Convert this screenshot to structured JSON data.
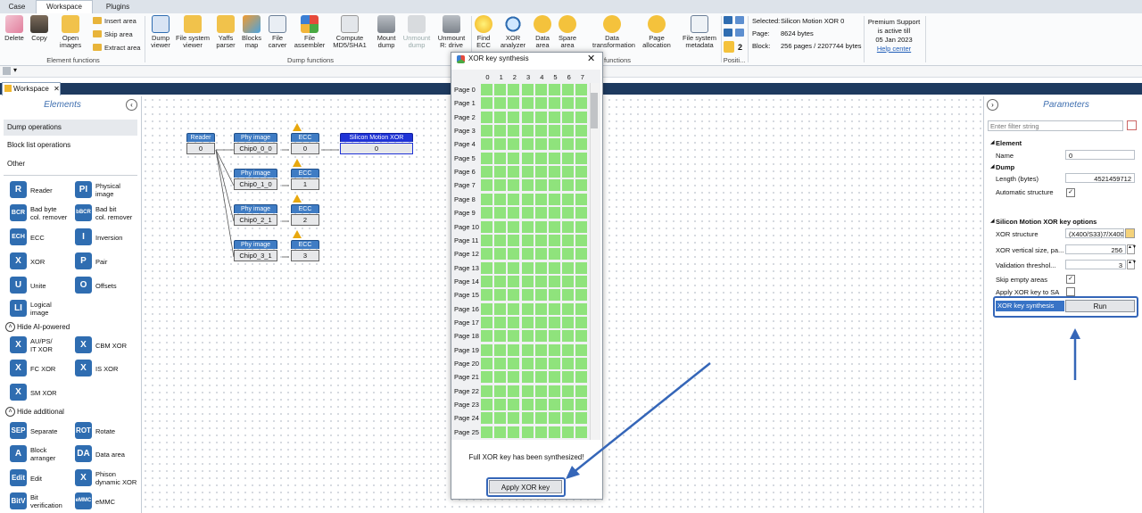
{
  "tabs": [
    "Case",
    "Workspace",
    "Plugins"
  ],
  "ribbon": {
    "buttons": [
      {
        "label": "Delete",
        "icon": "eraser-icon"
      },
      {
        "label": "Copy",
        "icon": "stamp-icon"
      },
      {
        "label": "Open\nimages",
        "icon": "folder-icon"
      },
      {
        "label": "Dump\nviewer",
        "icon": "binary-icon"
      },
      {
        "label": "File system\nviewer",
        "icon": "folders-icon"
      },
      {
        "label": "Yaffs\nparser",
        "icon": "folders-icon"
      },
      {
        "label": "Blocks\nmap",
        "icon": "cubes-icon"
      },
      {
        "label": "File\ncarver",
        "icon": "document-search-icon"
      },
      {
        "label": "File\nassembler",
        "icon": "puzzle-icon"
      },
      {
        "label": "Compute\nMD5/SHA1",
        "icon": "hash-icon"
      },
      {
        "label": "Mount\ndump",
        "icon": "drive-icon"
      },
      {
        "label": "Unmount\ndump",
        "icon": "drive-icon"
      },
      {
        "label": "Unmount\nR: drive",
        "icon": "drive-x-icon"
      },
      {
        "label": "Find\nECC",
        "icon": "bulb-icon"
      },
      {
        "label": "XOR\nanalyzer",
        "icon": "magnifier-icon"
      },
      {
        "label": "Data\narea",
        "icon": "question-icon"
      },
      {
        "label": "Spare\narea",
        "icon": "question-icon"
      },
      {
        "label": "Data\ntransformation",
        "icon": "question-icon"
      },
      {
        "label": "Page\nallocation",
        "icon": "question-icon"
      },
      {
        "label": "File system\nmetadata",
        "icon": "document-icon"
      }
    ],
    "small_buttons": [
      "Insert area",
      "Skip area",
      "Extract area"
    ],
    "groups": [
      "Element functions",
      "Dump functions",
      "functions",
      "Positi..."
    ],
    "position_value": "2",
    "selected": {
      "selected_label": "Selected:",
      "selected_value": "Silicon Motion XOR 0",
      "page_label": "Page:",
      "page_value": "8624 bytes",
      "block_label": "Block:",
      "block_value": "256 pages / 2207744 bytes"
    },
    "support": {
      "line1": "Premium Support",
      "line2": "is active till",
      "line3": "05 Jan 2023",
      "link": "Help center"
    }
  },
  "workspace_tab": "Workspace",
  "elements_panel": {
    "title": "Elements",
    "categories": [
      "Dump operations",
      "Block list operations",
      "Other"
    ],
    "items": [
      {
        "code": "R",
        "label": "Reader"
      },
      {
        "code": "PI",
        "label": "Physical\nimage"
      },
      {
        "code": "BCR",
        "label": "Bad byte\ncol. remover"
      },
      {
        "code": "bBCR",
        "label": "Bad bit\ncol. remover"
      },
      {
        "code": "ECH",
        "label": "ECC"
      },
      {
        "code": "I",
        "label": "Inversion"
      },
      {
        "code": "X",
        "label": "XOR"
      },
      {
        "code": "P",
        "label": "Pair"
      },
      {
        "code": "U",
        "label": "Unite"
      },
      {
        "code": "O",
        "label": "Offsets"
      },
      {
        "code": "LI",
        "label": "Logical\nimage"
      }
    ],
    "section_ai": "Hide AI-powered",
    "ai_items": [
      {
        "code": "X",
        "label": "AU/PS/\nIT XOR"
      },
      {
        "code": "X",
        "label": "CBM XOR"
      },
      {
        "code": "X",
        "label": "FC XOR"
      },
      {
        "code": "X",
        "label": "IS XOR"
      },
      {
        "code": "X",
        "label": "SM XOR"
      }
    ],
    "section_add": "Hide additional",
    "add_items": [
      {
        "code": "SEP",
        "label": "Separate"
      },
      {
        "code": "ROT",
        "label": "Rotate"
      },
      {
        "code": "A",
        "label": "Block\narranger"
      },
      {
        "code": "DA",
        "label": "Data area"
      },
      {
        "code": "Edit",
        "label": "Edit"
      },
      {
        "code": "X",
        "label": "Phison\ndynamic XOR"
      },
      {
        "code": "BitV",
        "label": "Bit\nverification"
      },
      {
        "code": "eMMC",
        "label": "eMMC"
      }
    ]
  },
  "graph": {
    "reader": {
      "title": "Reader",
      "value": "0"
    },
    "phy": [
      {
        "title": "Phy image",
        "value": "Chip0_0_0"
      },
      {
        "title": "Phy image",
        "value": "Chip0_1_0"
      },
      {
        "title": "Phy image",
        "value": "Chip0_2_1"
      },
      {
        "title": "Phy image",
        "value": "Chip0_3_1"
      }
    ],
    "ecc": [
      {
        "title": "ECC",
        "value": "0"
      },
      {
        "title": "ECC",
        "value": "1"
      },
      {
        "title": "ECC",
        "value": "2"
      },
      {
        "title": "ECC",
        "value": "3"
      }
    ],
    "xor": {
      "title": "Silicon Motion XOR",
      "value": "0"
    }
  },
  "dialog": {
    "title": "XOR key synthesis",
    "columns": [
      "0",
      "1",
      "2",
      "3",
      "4",
      "5",
      "6",
      "7"
    ],
    "pages": [
      "Page 0",
      "Page 1",
      "Page 2",
      "Page 3",
      "Page 4",
      "Page 5",
      "Page 6",
      "Page 7",
      "Page 8",
      "Page 9",
      "Page 10",
      "Page 11",
      "Page 12",
      "Page 13",
      "Page 14",
      "Page 15",
      "Page 16",
      "Page 17",
      "Page 18",
      "Page 19",
      "Page 20",
      "Page 21",
      "Page 22",
      "Page 23",
      "Page 24",
      "Page 25"
    ],
    "status": "Full XOR key has been synthesized!",
    "apply_button": "Apply XOR key",
    "cell_color": "#8fe37c"
  },
  "parameters": {
    "title": "Parameters",
    "filter_placeholder": "Enter filter string",
    "section_element": "Element",
    "name_label": "Name",
    "name_value": "0",
    "section_dump": "Dump",
    "length_label": "Length (bytes)",
    "length_value": "4521459712",
    "auto_struct_label": "Automatic structure",
    "section_sm": "Silicon Motion XOR key options",
    "xor_structure_label": "XOR structure",
    "xor_structure_value": "(X400/S33)7/X400/",
    "vertical_label": "XOR vertical size, pa...",
    "vertical_value": "256",
    "validation_label": "Validation threshol...",
    "validation_value": "3",
    "skip_empty_label": "Skip empty areas",
    "apply_xor_label": "Apply XOR key to SA",
    "synthesis_label": "XOR key synthesis",
    "run_button": "Run"
  }
}
